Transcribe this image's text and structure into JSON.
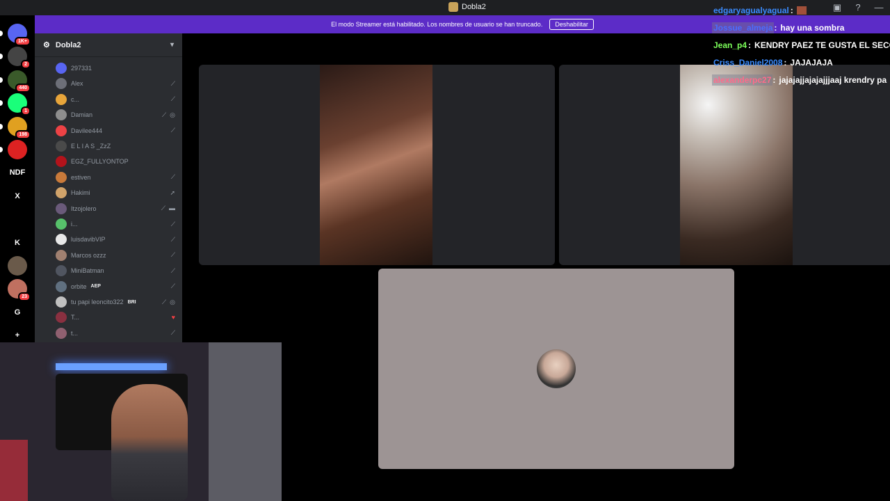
{
  "window": {
    "title": "Dobla2"
  },
  "banner": {
    "text": "El modo Streamer está habilitado. Los nombres de usuario se han truncado.",
    "button_label": "Deshabilitar"
  },
  "rail": {
    "items": [
      {
        "name": "discord-home",
        "badge": "1K+"
      },
      {
        "name": "server-avatar-1",
        "badge": "2"
      },
      {
        "name": "server-minecraft",
        "badge": "440"
      },
      {
        "name": "server-kick",
        "badge": "1"
      },
      {
        "name": "server-app",
        "badge": "198"
      },
      {
        "name": "server-spiderman",
        "badge": ""
      },
      {
        "name": "server-ndf",
        "label": "NDF"
      },
      {
        "name": "server-x",
        "label": "X"
      },
      {
        "name": "server-folder",
        "label": ""
      },
      {
        "name": "server-k",
        "label": "K"
      },
      {
        "name": "server-photo",
        "badge": ""
      },
      {
        "name": "server-face",
        "badge": "23"
      },
      {
        "name": "server-g",
        "label": "G"
      },
      {
        "name": "add-server",
        "label": "+"
      }
    ]
  },
  "sidebar": {
    "server_name": "Dobla2",
    "members": [
      {
        "name": "297331",
        "color": "#5865f2"
      },
      {
        "name": "Alex",
        "color": "#6d6f78"
      },
      {
        "name": "c...",
        "color": "#e8a53a"
      },
      {
        "name": "Damian",
        "color": "#8e8e8e"
      },
      {
        "name": "Davilee444",
        "color": "#ed4245"
      },
      {
        "name": "E L I A S _ZzZ",
        "color": "#4a4a4a"
      },
      {
        "name": "EGZ_FULLYONTOP",
        "color": "#b3131b"
      },
      {
        "name": "estiven",
        "color": "#c97a3a"
      },
      {
        "name": "Hakimi",
        "color": "#d1a36a"
      },
      {
        "name": "Itzojolero",
        "color": "#6a5a7a"
      },
      {
        "name": "i...",
        "color": "#57c16b"
      },
      {
        "name": "luisdavibVIP",
        "color": "#e8e8e8"
      },
      {
        "name": "Marcos ozzz",
        "color": "#a08070"
      },
      {
        "name": "MiniBatman",
        "color": "#505560"
      },
      {
        "name": "orbite",
        "color": "#607080",
        "tag": "AEP"
      },
      {
        "name": "tu papi leoncito322",
        "color": "#c0c0c0",
        "tag": "BRI"
      },
      {
        "name": "T...",
        "color": "#8a3040"
      },
      {
        "name": "t...",
        "color": "#906070"
      }
    ]
  },
  "chat": [
    {
      "user": "edgaryagualyagual",
      "msg": "",
      "color": "#3a8cff"
    },
    {
      "user": "Jossue_almeja",
      "msg": "hay una sombra",
      "color": "#4a6cff"
    },
    {
      "user": "Jean_p4",
      "msg": "KENDRY PAEZ TE GUSTA EL SECO",
      "color": "#7cff5a"
    },
    {
      "user": "Criss_Daniel2008",
      "msg": "JAJAJAJA",
      "color": "#3a8cff"
    },
    {
      "user": "alexanderpc27",
      "msg": "jajajajjajajajjjaaj krendry pa",
      "color": "#ff6a8a"
    }
  ]
}
